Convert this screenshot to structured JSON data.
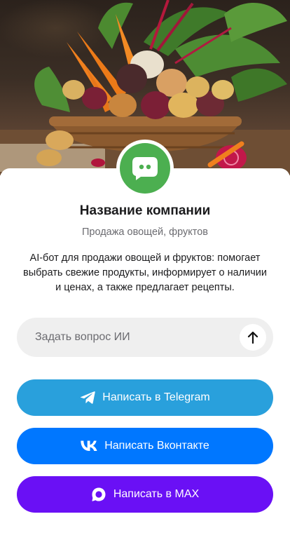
{
  "company": {
    "name": "Название компании",
    "tagline": "Продажа овощей, фруктов",
    "description": "AI-бот для продажи овощей и фруктов: помогает выбрать свежие продукты, информирует о наличии и ценах, а также предлагает рецепты.",
    "avatar_icon": "chat-bot-icon",
    "avatar_color": "#4caf50"
  },
  "hero": {
    "image_icon": "vegetable-basket-photo"
  },
  "ask": {
    "placeholder": "Задать вопрос ИИ",
    "send_icon": "arrow-up-icon"
  },
  "buttons": [
    {
      "label": "Написать в Telegram",
      "icon": "telegram-icon",
      "color": "#29a0dc"
    },
    {
      "label": "Написать Вконтакте",
      "icon": "vk-icon",
      "color": "#0077ff"
    },
    {
      "label": "Написать в MAX",
      "icon": "max-icon",
      "color": "#6a10f5"
    }
  ]
}
